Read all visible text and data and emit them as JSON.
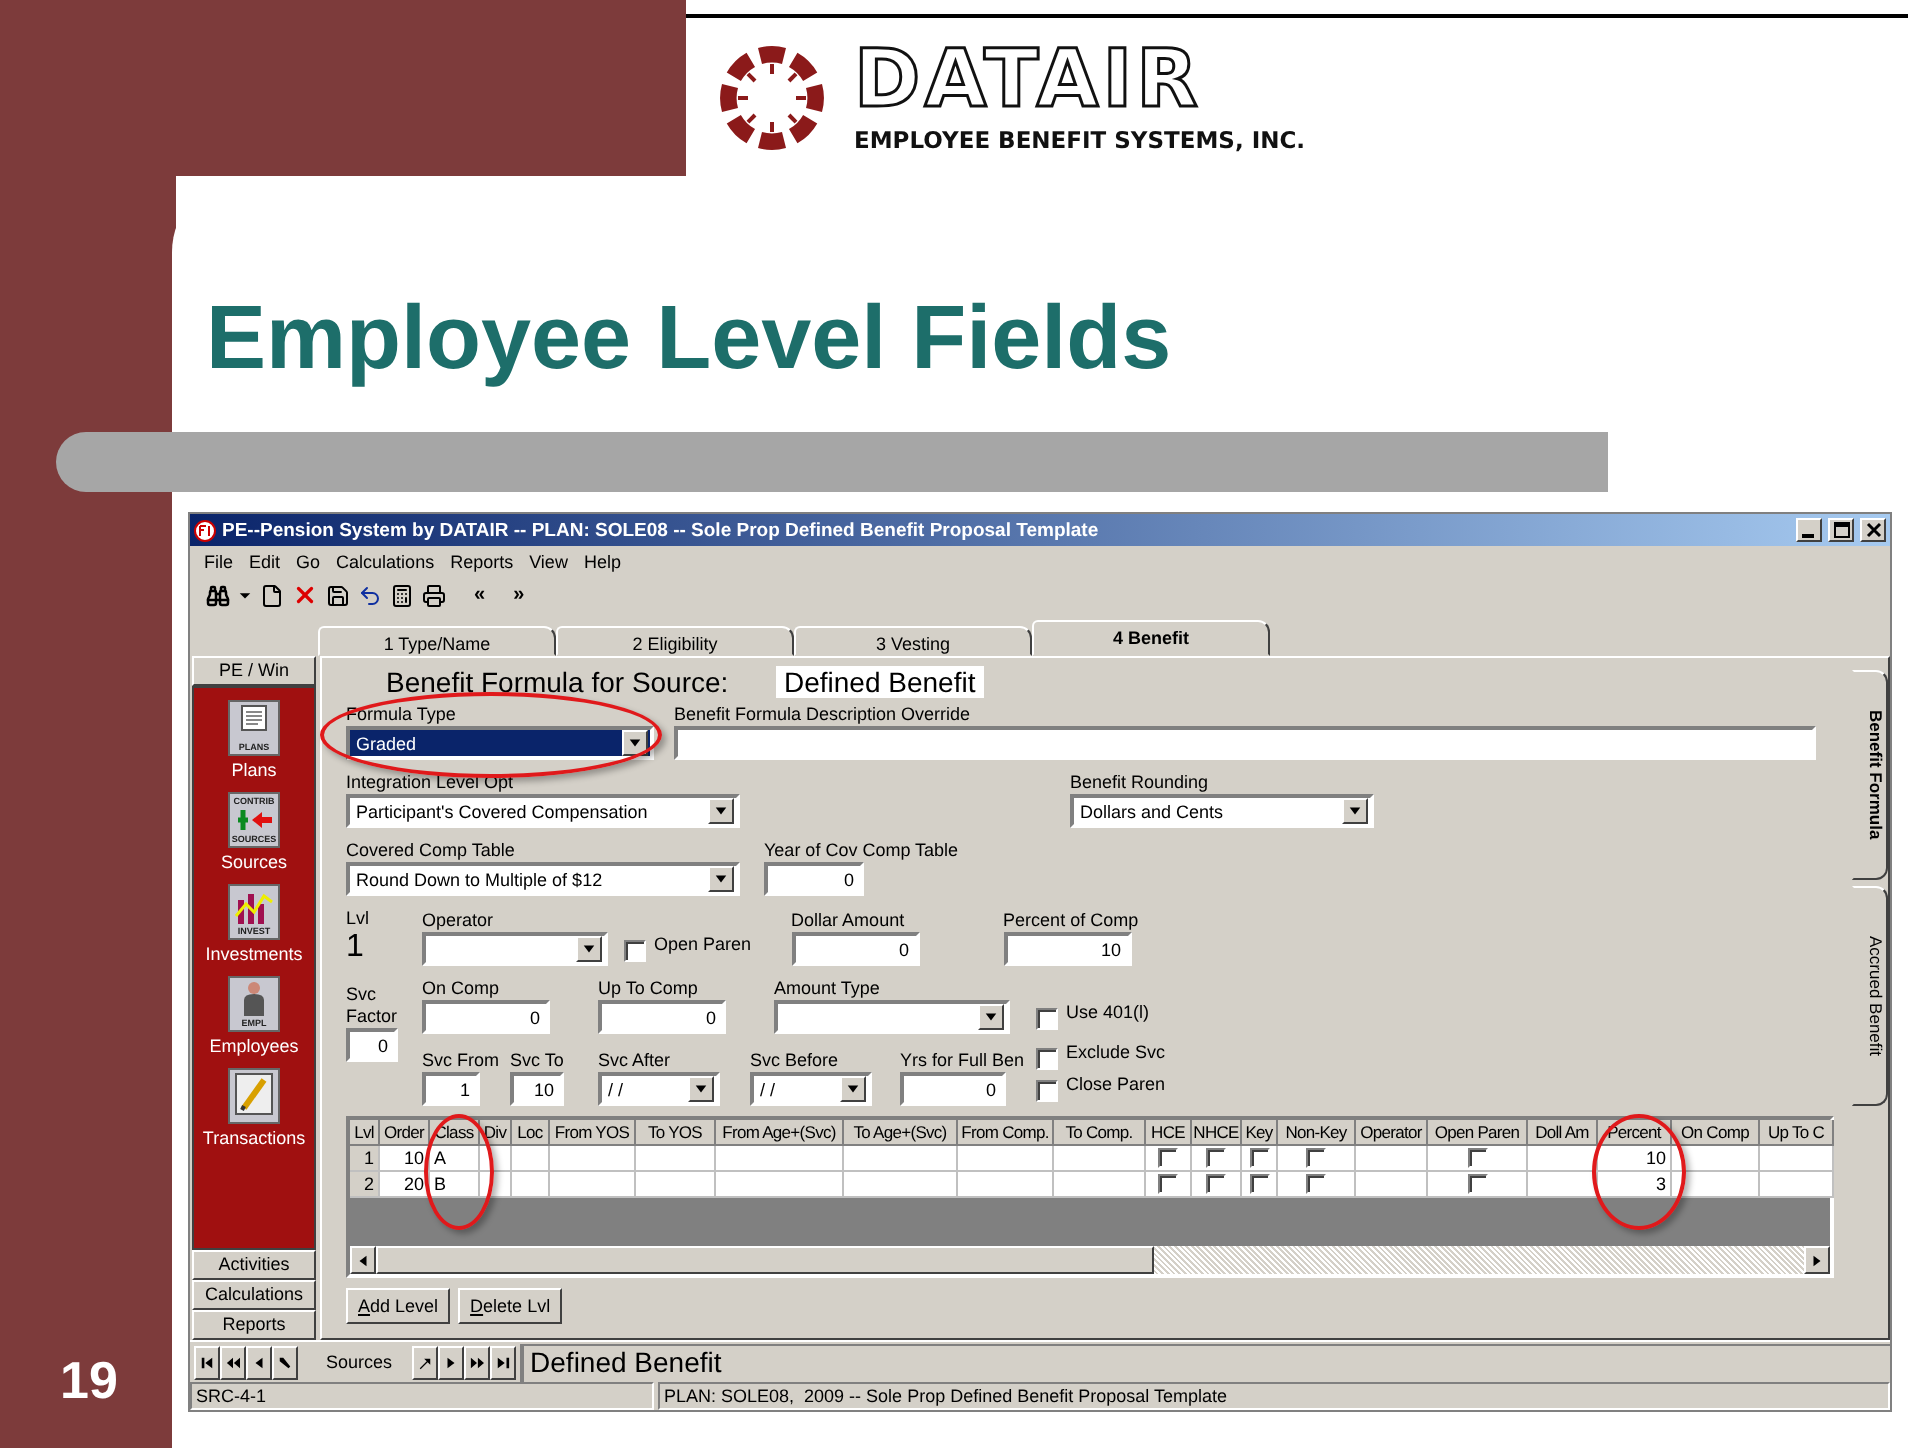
{
  "slide": {
    "title": "Employee Level Fields",
    "number": "19"
  },
  "logo": {
    "wordmark": "DATAIR",
    "tagline": "EMPLOYEE BENEFIT SYSTEMS, INC."
  },
  "window": {
    "title": "PE--Pension System by DATAIR -- PLAN: SOLE08 -- Sole Prop Defined Benefit Proposal Template"
  },
  "menu": [
    "File",
    "Edit",
    "Go",
    "Calculations",
    "Reports",
    "View",
    "Help"
  ],
  "toolbar": {
    "nav_buttons": [
      "«",
      "»"
    ]
  },
  "tabs": [
    {
      "label": "1 Type/Name",
      "selected": false
    },
    {
      "label": "2 Eligibility",
      "selected": false
    },
    {
      "label": "3 Vesting",
      "selected": false
    },
    {
      "label": "4 Benefit",
      "selected": true
    }
  ],
  "sidebar": {
    "header": "PE / Win",
    "items": [
      {
        "label": "Plans",
        "kind": "plans",
        "icon_text": [
          "PLANS"
        ]
      },
      {
        "label": "Sources",
        "kind": "sources",
        "icon_text": [
          "CONTRIB",
          "SOURCES"
        ]
      },
      {
        "label": "Investments",
        "kind": "investments",
        "icon_text": [
          "INVEST"
        ]
      },
      {
        "label": "Employees",
        "kind": "employees",
        "icon_text": [
          "EMPL"
        ]
      },
      {
        "label": "Transactions",
        "kind": "transactions"
      }
    ],
    "buttons": [
      "Activities",
      "Calculations",
      "Reports"
    ]
  },
  "form": {
    "heading": "Benefit Formula for Source:",
    "source": "Defined Benefit",
    "formula_type": {
      "label": "Formula Type",
      "value": "Graded",
      "selected": true,
      "highlighted": true
    },
    "description_override": {
      "label": "Benefit Formula Description Override"
    },
    "integration_level": {
      "label": "Integration Level Opt",
      "value": "Participant's Covered Compensation"
    },
    "benefit_rounding": {
      "label": "Benefit Rounding",
      "value": "Dollars and Cents"
    },
    "covered_comp_table": {
      "label": "Covered Comp Table",
      "value": "Round Down to Multiple of $12"
    },
    "year_cov_comp": {
      "label": "Year of Cov Comp Table",
      "value": "0"
    },
    "lvl": {
      "label": "Lvl",
      "value": "1"
    },
    "operator": {
      "label": "Operator"
    },
    "open_paren": {
      "label": "Open Paren",
      "checked": false
    },
    "dollar_amount": {
      "label": "Dollar Amount",
      "value": "0"
    },
    "percent_of_comp": {
      "label": "Percent of Comp",
      "value": "10"
    },
    "svc_factor": {
      "label": "Svc Factor",
      "value": "0"
    },
    "on_comp": {
      "label": "On Comp",
      "value": "0"
    },
    "up_to_comp": {
      "label": "Up To Comp",
      "value": "0"
    },
    "amount_type": {
      "label": "Amount Type"
    },
    "use_401l": {
      "label": "Use 401(l)",
      "checked": false
    },
    "svc_from": {
      "label": "Svc From",
      "value": "1"
    },
    "svc_to": {
      "label": "Svc To",
      "value": "10"
    },
    "svc_after": {
      "label": "Svc After",
      "value": "/ /"
    },
    "svc_before": {
      "label": "Svc Before",
      "value": "/ /"
    },
    "yrs_full_ben": {
      "label": "Yrs for Full Ben",
      "value": "0"
    },
    "exclude_svc": {
      "label": "Exclude Svc",
      "checked": false
    },
    "close_paren": {
      "label": "Close Paren",
      "checked": false
    }
  },
  "side_tabs": [
    {
      "label": "Benefit Formula",
      "selected": true
    },
    {
      "label": "Accrued Benefit",
      "selected": false
    }
  ],
  "grid": {
    "columns": [
      {
        "label": "Lvl",
        "kind": "header",
        "highlighted": false
      },
      {
        "label": "Order",
        "kind": "number",
        "highlighted": false
      },
      {
        "label": "Class",
        "kind": "text",
        "highlighted": true
      },
      {
        "label": "Div",
        "kind": "text",
        "highlighted": false
      },
      {
        "label": "Loc",
        "kind": "text",
        "highlighted": false
      },
      {
        "label": "From YOS",
        "kind": "text",
        "highlighted": false
      },
      {
        "label": "To YOS",
        "kind": "text",
        "highlighted": false
      },
      {
        "label": "From Age+(Svc)",
        "kind": "text",
        "highlighted": false
      },
      {
        "label": "To Age+(Svc)",
        "kind": "text",
        "highlighted": false
      },
      {
        "label": "From Comp.",
        "kind": "text",
        "highlighted": false
      },
      {
        "label": "To Comp.",
        "kind": "text",
        "highlighted": false
      },
      {
        "label": "HCE",
        "kind": "check",
        "highlighted": false
      },
      {
        "label": "NHCE",
        "kind": "check",
        "highlighted": false
      },
      {
        "label": "Key",
        "kind": "check",
        "highlighted": false
      },
      {
        "label": "Non-Key",
        "kind": "check",
        "highlighted": false
      },
      {
        "label": "Operator",
        "kind": "text",
        "highlighted": false
      },
      {
        "label": "Open Paren",
        "kind": "check",
        "highlighted": false
      },
      {
        "label": "Doll Am",
        "kind": "number",
        "highlighted": false
      },
      {
        "label": "Percent",
        "kind": "number",
        "highlighted": true
      },
      {
        "label": "On Comp",
        "kind": "number",
        "highlighted": false
      },
      {
        "label": "Up To C",
        "kind": "number",
        "highlighted": false
      }
    ],
    "rows": [
      {
        "cells": [
          "1",
          "10",
          "A",
          null,
          null,
          null,
          null,
          null,
          null,
          null,
          null,
          false,
          false,
          false,
          false,
          null,
          false,
          null,
          "10",
          null,
          null
        ]
      },
      {
        "cells": [
          "2",
          "20",
          "B",
          null,
          null,
          null,
          null,
          null,
          null,
          null,
          null,
          false,
          false,
          false,
          false,
          null,
          false,
          null,
          "3",
          null,
          null
        ]
      }
    ]
  },
  "buttons": [
    "Add Level",
    "Delete Lvl"
  ],
  "navigator": {
    "label": "Sources",
    "record": "Defined Benefit"
  },
  "status_bar": [
    "SRC-4-1",
    "PLAN: SOLE08,  2009 -- Sole Prop Defined Benefit Proposal Template"
  ]
}
